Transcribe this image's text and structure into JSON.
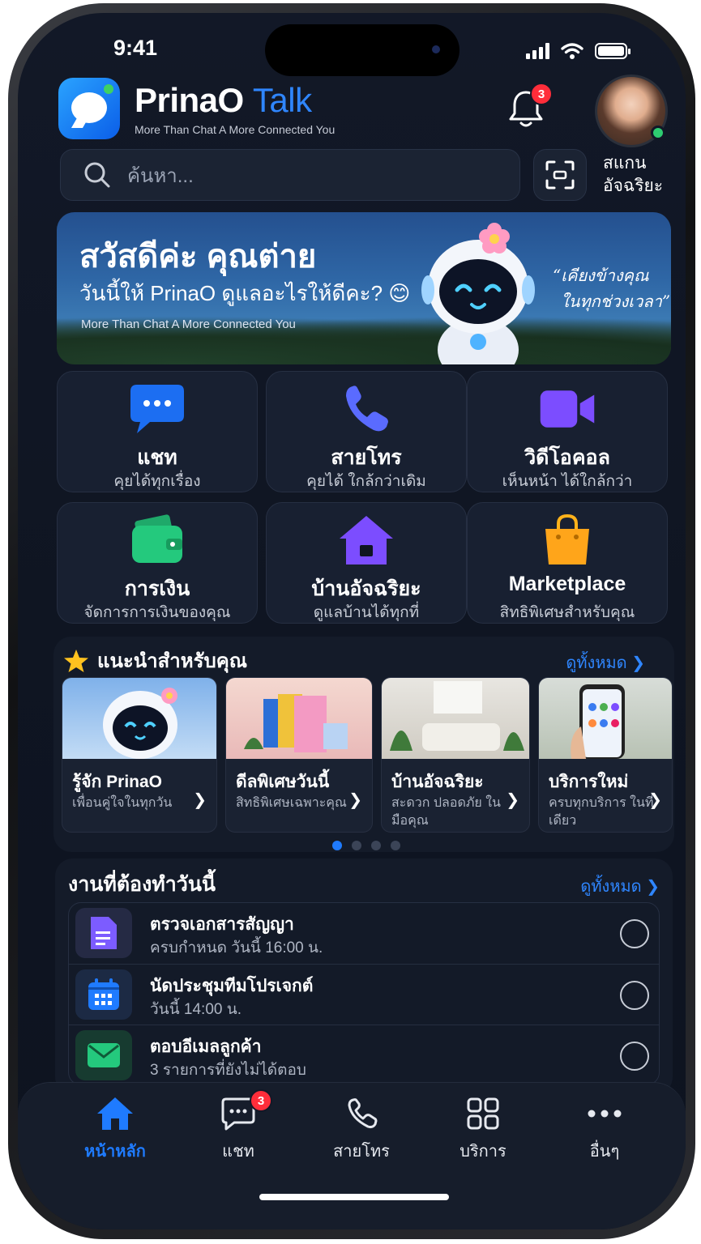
{
  "status": {
    "time": "9:41"
  },
  "header": {
    "brand_main": "PrinaO",
    "brand_accent": "Talk",
    "tagline": "More Than Chat  A More Connected You",
    "notification_count": "3"
  },
  "search": {
    "placeholder": "ค้นหา..."
  },
  "scan": {
    "line1": "สแกน",
    "line2": "อัจฉริยะ"
  },
  "hero": {
    "title": "สวัสดีค่ะ คุณต่าย",
    "subtitle": "วันนี้ให้ PrinaO ดูแลอะไรให้ดีคะ? 😊",
    "tagline": "More Than Chat  A More Connected You",
    "quote_line1": "“เคียงข้างคุณ",
    "quote_line2": "ในทุกช่วงเวลา”"
  },
  "tiles": [
    {
      "title": "แชท",
      "sub": "คุยได้ทุกเรื่อง",
      "icon": "chat-bubble-icon"
    },
    {
      "title": "สายโทร",
      "sub": "คุยได้ ใกล้กว่าเดิม",
      "icon": "phone-icon"
    },
    {
      "title": "วิดีโอคอล",
      "sub": "เห็นหน้า ได้ใกล้กว่า",
      "icon": "video-camera-icon"
    },
    {
      "title": "การเงิน",
      "sub": "จัดการการเงินของคุณ",
      "icon": "wallet-icon"
    },
    {
      "title": "บ้านอัจฉริยะ",
      "sub": "ดูแลบ้านได้ทุกที่",
      "icon": "home-icon"
    },
    {
      "title": "Marketplace",
      "sub": "สิทธิพิเศษสำหรับคุณ",
      "icon": "shopping-bag-icon"
    }
  ],
  "recommend": {
    "title": "แนะนำสำหรับคุณ",
    "see_all": "ดูทั้งหมด",
    "cards": [
      {
        "title": "รู้จัก PrinaO",
        "sub": "เพื่อนคู่ใจในทุกวัน"
      },
      {
        "title": "ดีลพิเศษวันนี้",
        "sub": "สิทธิพิเศษเฉพาะคุณ"
      },
      {
        "title": "บ้านอัจฉริยะ",
        "sub": "สะดวก ปลอดภัย ในมือคุณ"
      },
      {
        "title": "บริการใหม่",
        "sub": "ครบทุกบริการ ในที่เดียว"
      }
    ],
    "page_index": 1,
    "page_count": 4
  },
  "tasks": {
    "title": "งานที่ต้องทำวันนี้",
    "see_all": "ดูทั้งหมด",
    "items": [
      {
        "title": "ตรวจเอกสารสัญญา",
        "sub": "ครบกำหนด วันนี้ 16:00 น.",
        "icon": "document-icon",
        "done": false
      },
      {
        "title": "นัดประชุมทีมโปรเจกต์",
        "sub": "วันนี้ 14:00 น.",
        "icon": "calendar-icon",
        "done": false
      },
      {
        "title": "ตอบอีเมลลูกค้า",
        "sub": "3 รายการที่ยังไม่ได้ตอบ",
        "icon": "mail-icon",
        "done": false
      }
    ]
  },
  "tabbar": {
    "home": "หน้าหลัก",
    "chat": "แชท",
    "chat_badge": "3",
    "calls": "สายโทร",
    "services": "บริการ",
    "more": "อื่นๆ"
  },
  "colors": {
    "accent": "#1f7bff",
    "badge": "#ff2d3a",
    "background": "#121827"
  }
}
